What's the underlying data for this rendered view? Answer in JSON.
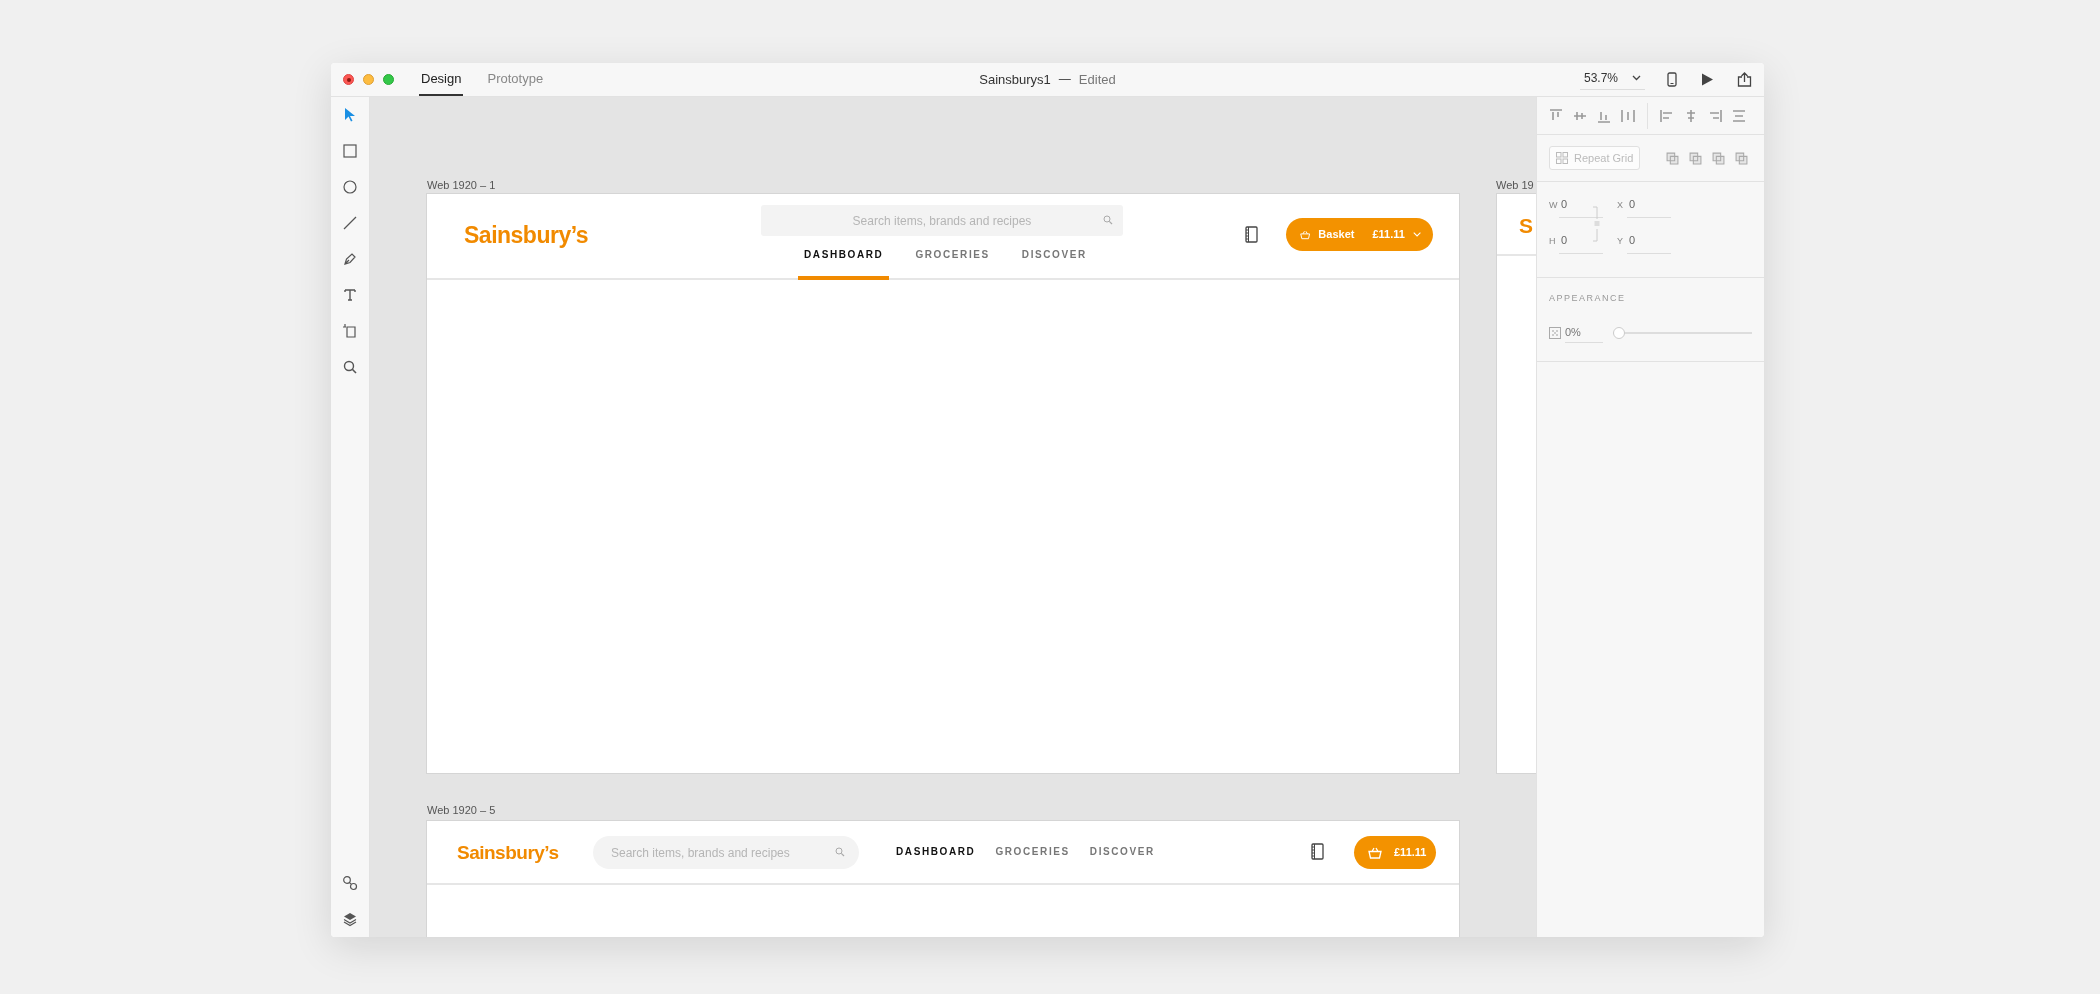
{
  "window": {
    "title": "Sainsburys1",
    "status": "Edited"
  },
  "mode_tabs": [
    {
      "label": "Design",
      "selected": true
    },
    {
      "label": "Prototype",
      "selected": false
    }
  ],
  "zoom": {
    "value": "53.7%"
  },
  "tools": [
    {
      "kind": "select",
      "selected": true
    },
    {
      "kind": "rectangle",
      "selected": false
    },
    {
      "kind": "ellipse",
      "selected": false
    },
    {
      "kind": "line",
      "selected": false
    },
    {
      "kind": "pen",
      "selected": false
    },
    {
      "kind": "text",
      "selected": false
    },
    {
      "kind": "artboard",
      "selected": false
    },
    {
      "kind": "zoom",
      "selected": false
    }
  ],
  "bottom_tools": [
    {
      "kind": "symbols"
    },
    {
      "kind": "layers"
    }
  ],
  "artboards": [
    {
      "kind": "wide",
      "label": "Web 1920 – 1",
      "logo": "Sainsbury’s",
      "search_placeholder": "Search items, brands and recipes",
      "nav": [
        {
          "label": "DASHBOARD",
          "selected": true
        },
        {
          "label": "GROCERIES",
          "selected": false
        },
        {
          "label": "DISCOVER",
          "selected": false
        }
      ],
      "basket": {
        "label": "Basket",
        "amount": "£11.11"
      }
    },
    {
      "kind": "partial",
      "label": "Web 19",
      "logo": "S"
    },
    {
      "kind": "compact",
      "label": "Web 1920 – 5",
      "logo": "Sainsbury’s",
      "search_placeholder": "Search items, brands and recipes",
      "nav": [
        {
          "label": "DASHBOARD",
          "selected": true
        },
        {
          "label": "GROCERIES",
          "selected": false
        },
        {
          "label": "DISCOVER",
          "selected": false
        }
      ],
      "basket": {
        "amount": "£11.11"
      }
    }
  ],
  "properties": {
    "repeat_grid": "Repeat Grid",
    "fields": [
      {
        "label": "W",
        "value": "0"
      },
      {
        "label": "X",
        "value": "0"
      },
      {
        "label": "H",
        "value": "0"
      },
      {
        "label": "Y",
        "value": "0"
      }
    ],
    "appearance": {
      "title": "APPEARANCE",
      "opacity": "0%",
      "level": 0
    }
  }
}
